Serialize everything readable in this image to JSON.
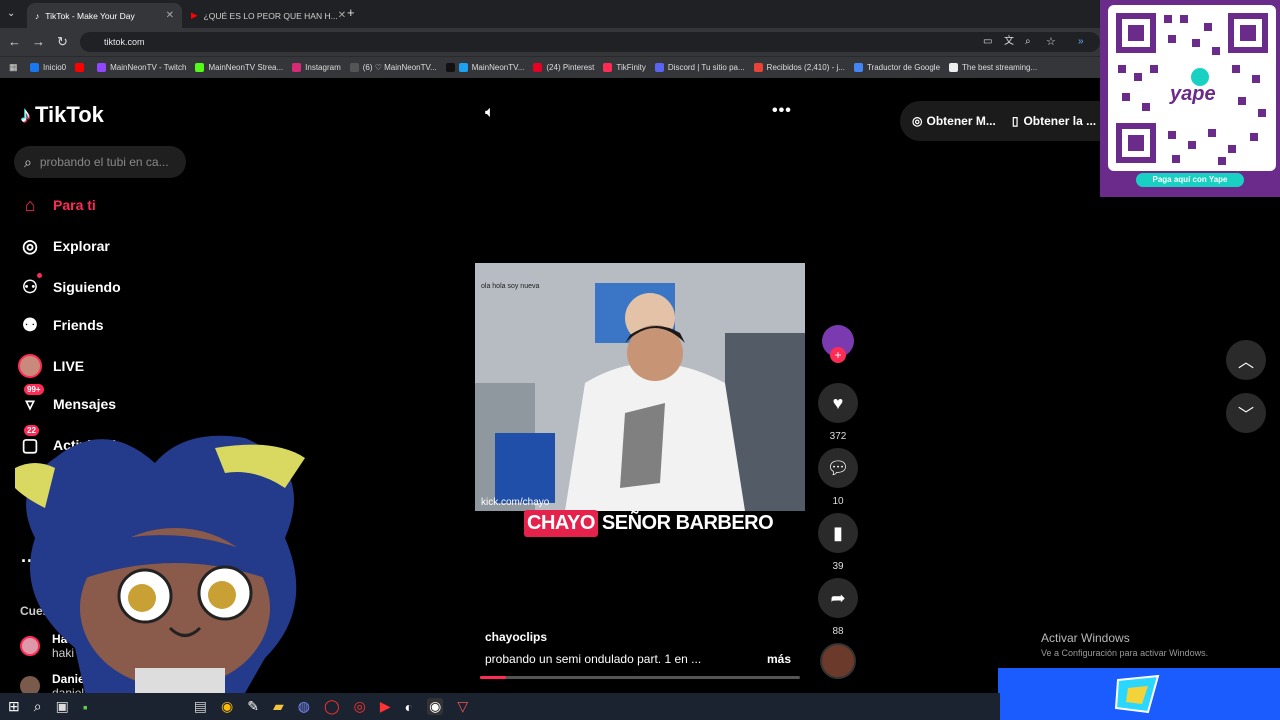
{
  "browser": {
    "tabs": [
      {
        "label": "TikTok - Make Your Day"
      },
      {
        "label": "¿QUÉ ES LO PEOR QUE HAN H..."
      }
    ],
    "url": "tiktok.com",
    "bookmarks": [
      "Inicio0",
      "MainNeonTV - Twitch",
      "MainNeonTV Strea...",
      "Instagram",
      "(6) ♡ MainNeonTV...",
      "",
      "MainNeonTV...",
      "(24) Pinterest",
      "TikFinity",
      "Discord | Tu sitio pa...",
      "Recibidos (2,410) - j...",
      "Traductor de Google",
      "The best streaming..."
    ]
  },
  "tiktok": {
    "logo": "TikTok",
    "search_placeholder": "probando el tubi en ca...",
    "nav": [
      {
        "label": "Para ti",
        "active": true
      },
      {
        "label": "Explorar"
      },
      {
        "label": "Siguiendo"
      },
      {
        "label": "Friends"
      },
      {
        "label": "LIVE"
      },
      {
        "label": "Mensajes",
        "badge": "99+"
      },
      {
        "label": "Actividad",
        "badge": "22"
      }
    ],
    "more_label": "Ma",
    "following_header": "Cuenta",
    "accounts": [
      {
        "name": "Ha",
        "handle": "haki"
      },
      {
        "name": "Daniela Valdez",
        "handle": "daniela_natali"
      }
    ],
    "get_buttons": [
      "Obtener M...",
      "Obtener la ..."
    ],
    "video": {
      "watermark": "kick.com/chayo",
      "caption_highlight": "CHAYO",
      "caption_rest": "SEÑOR BARBERO",
      "author": "chayoclips",
      "description": "probando un semi ondulado part. 1 en ...",
      "more": "más"
    },
    "actions": {
      "likes": "372",
      "comments": "10",
      "saves": "39",
      "shares": "88"
    }
  },
  "overlay": {
    "qr_button": "Paga aquí con Yape",
    "qr_brand": "yape",
    "windows_line1": "Activar Windows",
    "windows_line2": "Ve a Configuración para activar Windows."
  },
  "colors": {
    "accent": "#fe2c55",
    "yape_purple": "#6a2b8a",
    "yape_teal": "#18d1c3"
  }
}
